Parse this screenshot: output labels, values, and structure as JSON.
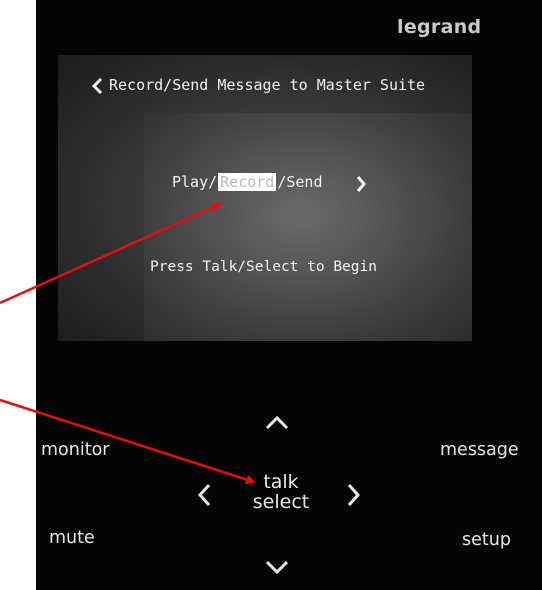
{
  "device": {
    "brand": "legrand"
  },
  "screen": {
    "title": "Record/Send Message to Master Suite",
    "modes": [
      "Play",
      "Record",
      "Send"
    ],
    "mode_separator": "/",
    "selected_mode": "Record",
    "prompt": "Press Talk/Select to Begin"
  },
  "buttons": {
    "monitor": "monitor",
    "message": "message",
    "mute": "mute",
    "setup": "setup",
    "talk": "talk",
    "select": "select"
  },
  "icons": {
    "back": "chevron-left-icon",
    "next_mode": "chevron-right-icon",
    "nav_up": "chevron-up-icon",
    "nav_down": "chevron-down-icon",
    "nav_left": "chevron-left-icon",
    "nav_right": "chevron-right-icon"
  },
  "colors": {
    "panel": "#050505",
    "text": "#e8e8e8",
    "annotation_arrow": "#e01010",
    "highlight": "#ffffff"
  }
}
